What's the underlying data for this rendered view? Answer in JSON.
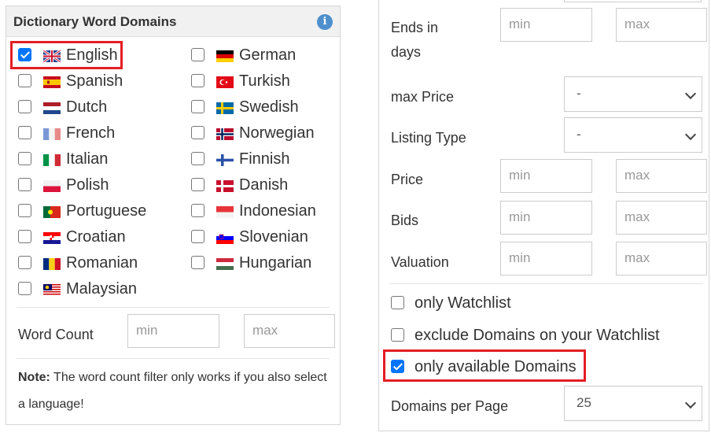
{
  "left": {
    "title": "Dictionary Word Domains",
    "info_icon": "i",
    "languages": [
      {
        "label": "English",
        "checked": true,
        "flag": "uk"
      },
      {
        "label": "Spanish",
        "checked": false,
        "flag": "es"
      },
      {
        "label": "Dutch",
        "checked": false,
        "flag": "nl"
      },
      {
        "label": "French",
        "checked": false,
        "flag": "fr"
      },
      {
        "label": "Italian",
        "checked": false,
        "flag": "it"
      },
      {
        "label": "Polish",
        "checked": false,
        "flag": "pl"
      },
      {
        "label": "Portuguese",
        "checked": false,
        "flag": "pt"
      },
      {
        "label": "Croatian",
        "checked": false,
        "flag": "hr"
      },
      {
        "label": "Romanian",
        "checked": false,
        "flag": "ro"
      },
      {
        "label": "Malaysian",
        "checked": false,
        "flag": "my"
      },
      {
        "label": "German",
        "checked": false,
        "flag": "de"
      },
      {
        "label": "Turkish",
        "checked": false,
        "flag": "tr"
      },
      {
        "label": "Swedish",
        "checked": false,
        "flag": "se"
      },
      {
        "label": "Norwegian",
        "checked": false,
        "flag": "no"
      },
      {
        "label": "Finnish",
        "checked": false,
        "flag": "fi"
      },
      {
        "label": "Danish",
        "checked": false,
        "flag": "dk"
      },
      {
        "label": "Indonesian",
        "checked": false,
        "flag": "id"
      },
      {
        "label": "Slovenian",
        "checked": false,
        "flag": "si"
      },
      {
        "label": "Hungarian",
        "checked": false,
        "flag": "hu"
      }
    ],
    "word_count": {
      "label": "Word Count",
      "min_placeholder": "min",
      "max_placeholder": "max"
    },
    "note_bold": "Note:",
    "note_text": " The word count filter only works if you also select a language!"
  },
  "right": {
    "ends_in": {
      "label_line1": "Ends in",
      "label_line2": "days",
      "min_placeholder": "min",
      "max_placeholder": "max"
    },
    "max_price": {
      "label": "max Price",
      "value": "-"
    },
    "listing_type": {
      "label": "Listing Type",
      "value": "-"
    },
    "price": {
      "label": "Price",
      "min_placeholder": "min",
      "max_placeholder": "max"
    },
    "bids": {
      "label": "Bids",
      "min_placeholder": "min",
      "max_placeholder": "max"
    },
    "valuation": {
      "label": "Valuation",
      "min_placeholder": "min",
      "max_placeholder": "max"
    },
    "only_watchlist": {
      "label": "only Watchlist",
      "checked": false
    },
    "exclude_watchlist": {
      "label": "exclude Domains on your Watchlist",
      "checked": false
    },
    "only_available": {
      "label": "only available Domains",
      "checked": true
    },
    "per_page": {
      "label": "Domains per Page",
      "value": "25"
    }
  },
  "colors": {
    "checkbox_checked": "#0075ff",
    "highlight_box": "#e31e24",
    "info_icon": "#4f8fce"
  }
}
